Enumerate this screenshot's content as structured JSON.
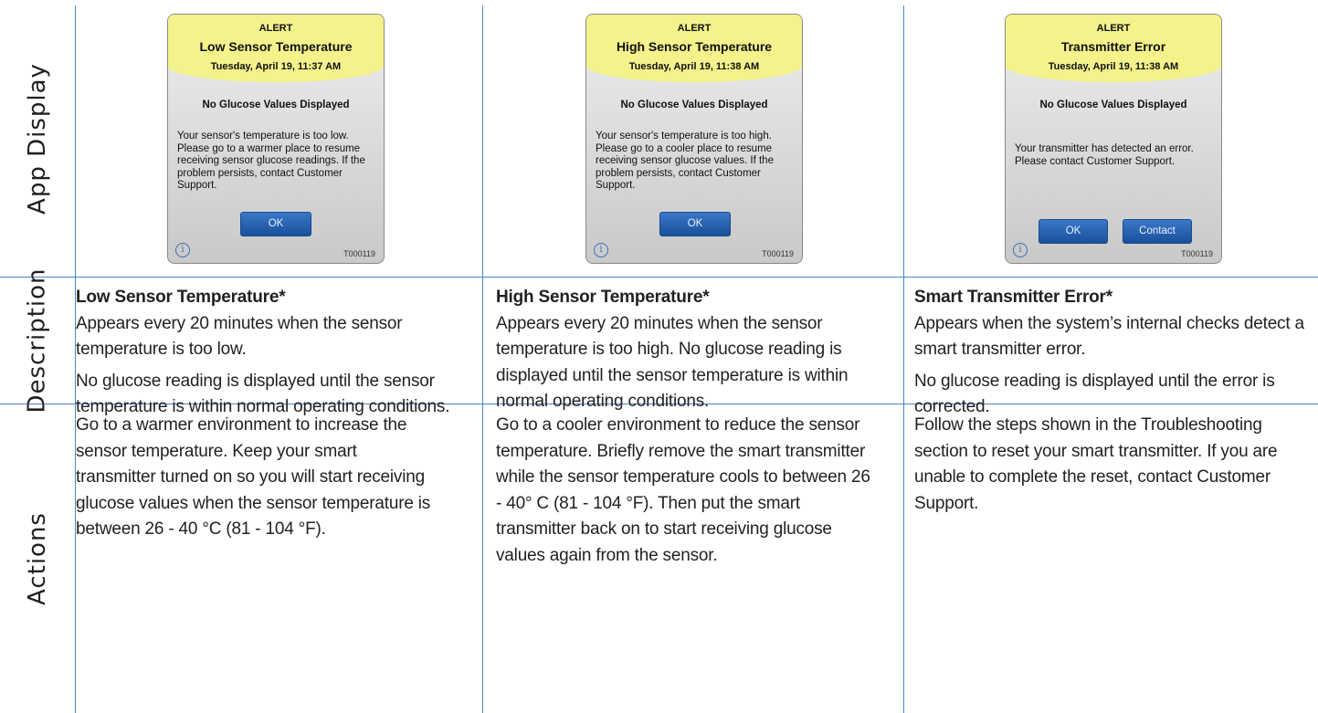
{
  "row_labels": {
    "app": "App Display",
    "description": "Description",
    "actions": "Actions"
  },
  "columns": [
    {
      "screen": {
        "alert": "ALERT",
        "title": "Low Sensor Temperature",
        "date": "Tuesday, April 19, 11:37 AM",
        "subtitle": "No Glucose Values Displayed",
        "message": "Your sensor's temperature is too low. Please go to a warmer place to resume receiving sensor glucose readings. If the problem persists, contact Customer Support.",
        "ok_label": "OK",
        "info_glyph": "i",
        "code": "T000119"
      },
      "description": {
        "title": "Low Sensor Temperature*",
        "paragraphs": [
          "Appears every 20 minutes when the sensor temperature is too low.",
          "No glucose reading is displayed until the sensor temperature is within normal operating conditions."
        ]
      },
      "actions": "Go to a warmer environment to increase the sensor temperature. Keep your smart transmitter turned on so you will start receiving glucose values when the sensor temperature is between 26 - 40 °C (81 - 104 °F)."
    },
    {
      "screen": {
        "alert": "ALERT",
        "title": "High Sensor Temperature",
        "date": "Tuesday, April 19, 11:38 AM",
        "subtitle": "No Glucose Values Displayed",
        "message": "Your sensor's temperature is too high. Please go to a cooler place to resume receiving sensor glucose values. If the problem persists, contact Customer Support.",
        "ok_label": "OK",
        "info_glyph": "i",
        "code": "T000119"
      },
      "description": {
        "title": "High Sensor Temperature*",
        "paragraphs": [
          "Appears every 20 minutes when the sensor temperature is too high. No glucose reading is displayed until the sensor temperature is within normal operating conditions."
        ]
      },
      "actions": "Go to a cooler environment to reduce the sensor temperature. Briefly remove the smart transmitter while the sensor temperature cools to between 26 - 40° C (81 - 104 °F). Then put the smart transmitter back on to start receiving glucose values again from the sensor."
    },
    {
      "screen": {
        "alert": "ALERT",
        "title": "Transmitter Error",
        "date": "Tuesday, April 19, 11:38 AM",
        "subtitle": "No Glucose Values Displayed",
        "message": "Your transmitter has detected an error. Please contact Customer Support.",
        "ok_label": "OK",
        "contact_label": "Contact",
        "info_glyph": "i",
        "code": "T000119"
      },
      "description": {
        "title": "Smart Transmitter Error*",
        "paragraphs": [
          "Appears when the system’s internal checks detect a smart transmitter error.",
          "No glucose reading is displayed until the error is corrected."
        ]
      },
      "actions": "Follow the steps shown in the Troubleshooting section to reset your smart transmitter. If you are unable to complete the reset, contact Customer Support."
    }
  ]
}
